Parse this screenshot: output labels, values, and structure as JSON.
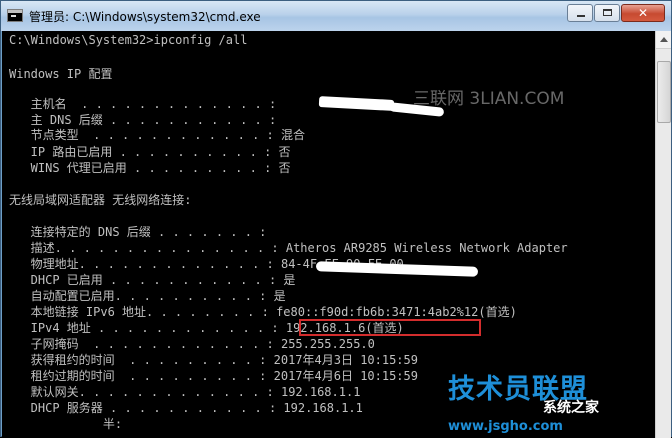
{
  "window": {
    "title": "管理员: C:\\Windows\\system32\\cmd.exe",
    "close_glyph": "✕"
  },
  "console": {
    "lines": [
      "C:\\Windows\\System32>ipconfig /all",
      "",
      "Windows IP 配置",
      "",
      "   主机名  . . . . . . . . . . . . . : ",
      "   主 DNS 后缀 . . . . . . . . . . . : ",
      "   节点类型  . . . . . . . . . . . . : 混合",
      "   IP 路由已启用 . . . . . . . . . . : 否",
      "   WINS 代理已启用 . . . . . . . . . : 否",
      "",
      "无线局域网适配器 无线网络连接:",
      "",
      "   连接特定的 DNS 后缀 . . . . . . . : ",
      "   描述. . . . . . . . . . . . . . . : Atheros AR9285 Wireless Network Adapter",
      "   物理地址. . . . . . . . . . . . . : 84-4F-FF-90-FE-00",
      "   DHCP 已启用 . . . . . . . . . . . : 是",
      "   自动配置已启用. . . . . . . . . . : 是",
      "   本地链接 IPv6 地址. . . . . . . . : fe80::f90d:fb6b:3471:4ab2%12(首选)",
      "   IPv4 地址 . . . . . . . . . . . . : 192.168.1.6(首选)",
      "   子网掩码  . . . . . . . . . . . . : 255.255.255.0",
      "   获得租约的时间  . . . . . . . . . : 2017年4月3日 10:15:59",
      "   租约过期的时间  . . . . . . . . . : 2017年4月6日 10:15:59",
      "   默认网关. . . . . . . . . . . . . : 192.168.1.1",
      "   DHCP 服务器 . . . . . . . . . . . : 192.168.1.1",
      "             半:"
    ]
  },
  "watermarks": {
    "site1": "三联网 3LIAN.COM",
    "site2_main": "技术员联盟",
    "site2_sub": "系统之家",
    "site2_url": "www.jsgho.com"
  },
  "colors": {
    "console_bg": "#000000",
    "console_text": "#c0c0c0",
    "highlight_box": "#d32d2d",
    "title_bar": "#b9d1ea"
  },
  "icons": [
    "cmd-app-icon",
    "minimize-icon",
    "maximize-icon",
    "close-icon",
    "scroll-up-arrow-icon"
  ]
}
